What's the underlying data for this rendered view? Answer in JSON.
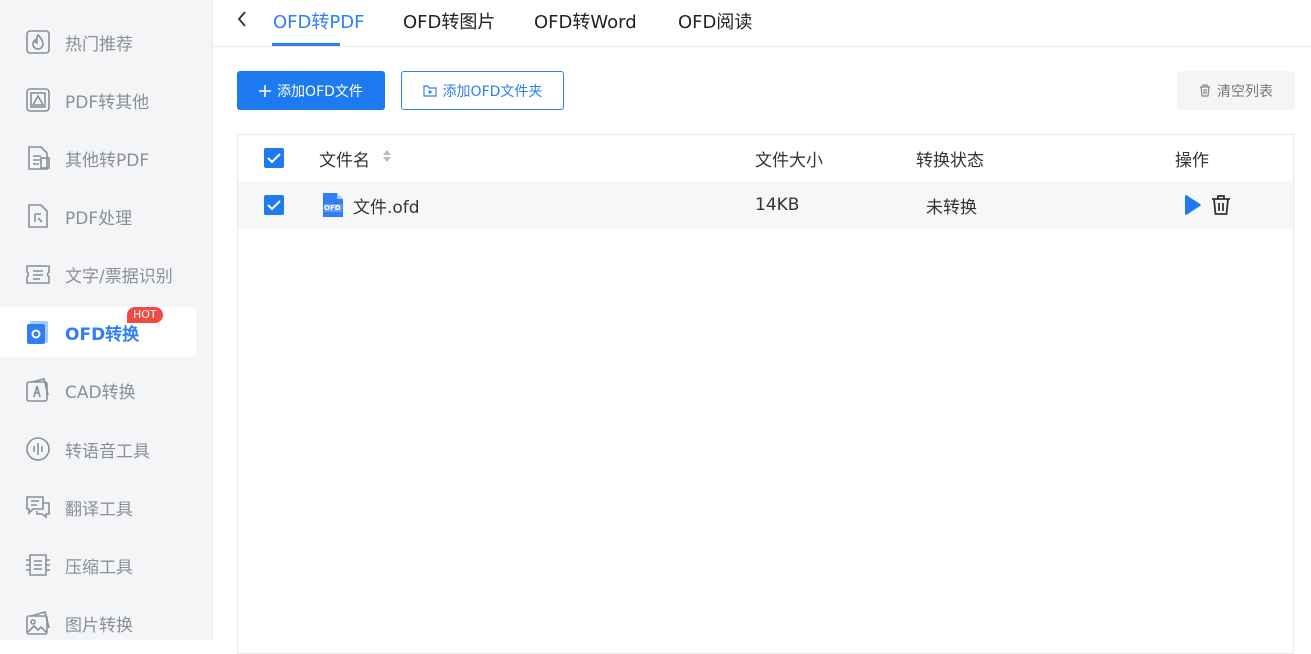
{
  "sidebar": {
    "items": [
      {
        "label": "热门推荐",
        "icon": "hot-recommend-icon"
      },
      {
        "label": "PDF转其他",
        "icon": "pdf-to-other-icon"
      },
      {
        "label": "其他转PDF",
        "icon": "other-to-pdf-icon"
      },
      {
        "label": "PDF处理",
        "icon": "pdf-process-icon"
      },
      {
        "label": "文字/票据识别",
        "icon": "ocr-ticket-icon"
      },
      {
        "label": "OFD转换",
        "icon": "ofd-convert-icon",
        "active": true,
        "badge": "HOT"
      },
      {
        "label": "CAD转换",
        "icon": "cad-convert-icon"
      },
      {
        "label": "转语音工具",
        "icon": "voice-icon"
      },
      {
        "label": "翻译工具",
        "icon": "translate-icon"
      },
      {
        "label": "压缩工具",
        "icon": "compress-icon"
      },
      {
        "label": "图片转换",
        "icon": "image-convert-icon"
      }
    ]
  },
  "tabs": [
    {
      "label": "OFD转PDF",
      "active": true
    },
    {
      "label": "OFD转图片"
    },
    {
      "label": "OFD转Word"
    },
    {
      "label": "OFD阅读"
    }
  ],
  "toolbar": {
    "add_file": "添加OFD文件",
    "add_folder": "添加OFD文件夹",
    "clear": "清空列表"
  },
  "table": {
    "headers": {
      "name": "文件名",
      "size": "文件大小",
      "status": "转换状态",
      "action": "操作"
    },
    "rows": [
      {
        "name": "文件.ofd",
        "size": "14KB",
        "status": "未转换",
        "file_icon_text": "OFD",
        "checked": true
      }
    ]
  },
  "colors": {
    "accent": "#1e7af0",
    "badge": "#ef4b42",
    "sidebar_bg": "#f4f5f7"
  }
}
